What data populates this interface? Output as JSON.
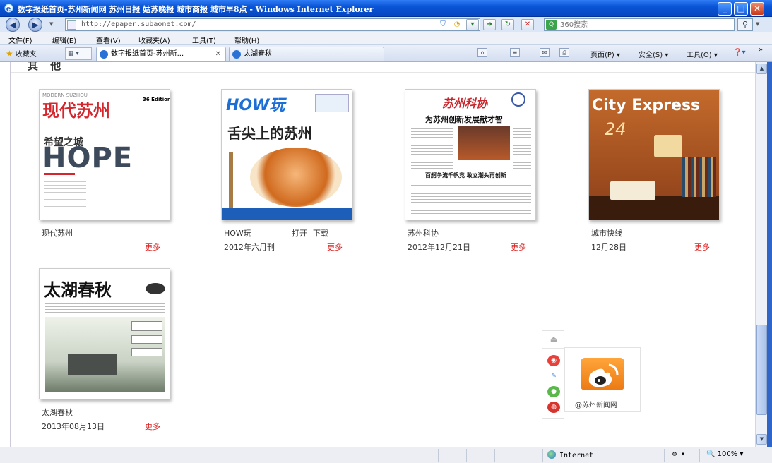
{
  "window": {
    "title": "数字报纸首页-苏州新闻网 苏州日报 姑苏晚报 城市商报 城市早8点 - Windows Internet Explorer"
  },
  "address": {
    "url": "http://epaper.subaonet.com/",
    "search_placeholder": "360搜索"
  },
  "menu": {
    "items": [
      "文件(F)",
      "编辑(E)",
      "查看(V)",
      "收藏夹(A)",
      "工具(T)",
      "帮助(H)"
    ]
  },
  "tabs": {
    "favorites_label": "收藏夹",
    "items": [
      {
        "label": "数字报纸首页-苏州新..."
      },
      {
        "label": "太湖春秋"
      }
    ]
  },
  "commandbar": {
    "page": "页面(P)",
    "safety": "安全(S)",
    "tools": "工具(O)"
  },
  "section": {
    "title": "其 他"
  },
  "publications": [
    {
      "title": "现代苏州",
      "date": "",
      "more": "更多",
      "actions": []
    },
    {
      "title": "HOW玩",
      "date": "2012年六月刊",
      "more": "更多",
      "actions": [
        "打开",
        "下载"
      ]
    },
    {
      "title": "苏州科协",
      "date": "2012年12月21日",
      "more": "更多",
      "actions": []
    },
    {
      "title": "城市快线",
      "date": "12月28日",
      "more": "更多",
      "actions": []
    },
    {
      "title": "太湖春秋",
      "date": "2013年08月13日",
      "more": "更多",
      "actions": []
    }
  ],
  "covers": {
    "xiandai": {
      "brand": "现代苏州",
      "sub": "MODERN SUZHOU",
      "headline": "希望之城",
      "big": "HOPE",
      "issue": "36 Edition"
    },
    "howan": {
      "brand": "HOW玩",
      "headline": "舌尖上的苏州"
    },
    "kexie": {
      "brand": "苏州科协",
      "headline": "为苏州创新发展献才智",
      "sub": "百舸争流千帆竞 敢立潮头再创新"
    },
    "city": {
      "brand": "City Express",
      "big": "24"
    },
    "taihu": {
      "brand": "太湖春秋"
    }
  },
  "share": {
    "weibo_label": "@苏州新闻网"
  },
  "status": {
    "zone": "Internet",
    "zoom": "100%"
  },
  "colors": {
    "more_link": "#dd2222",
    "titlebar": "#0a54d6"
  }
}
